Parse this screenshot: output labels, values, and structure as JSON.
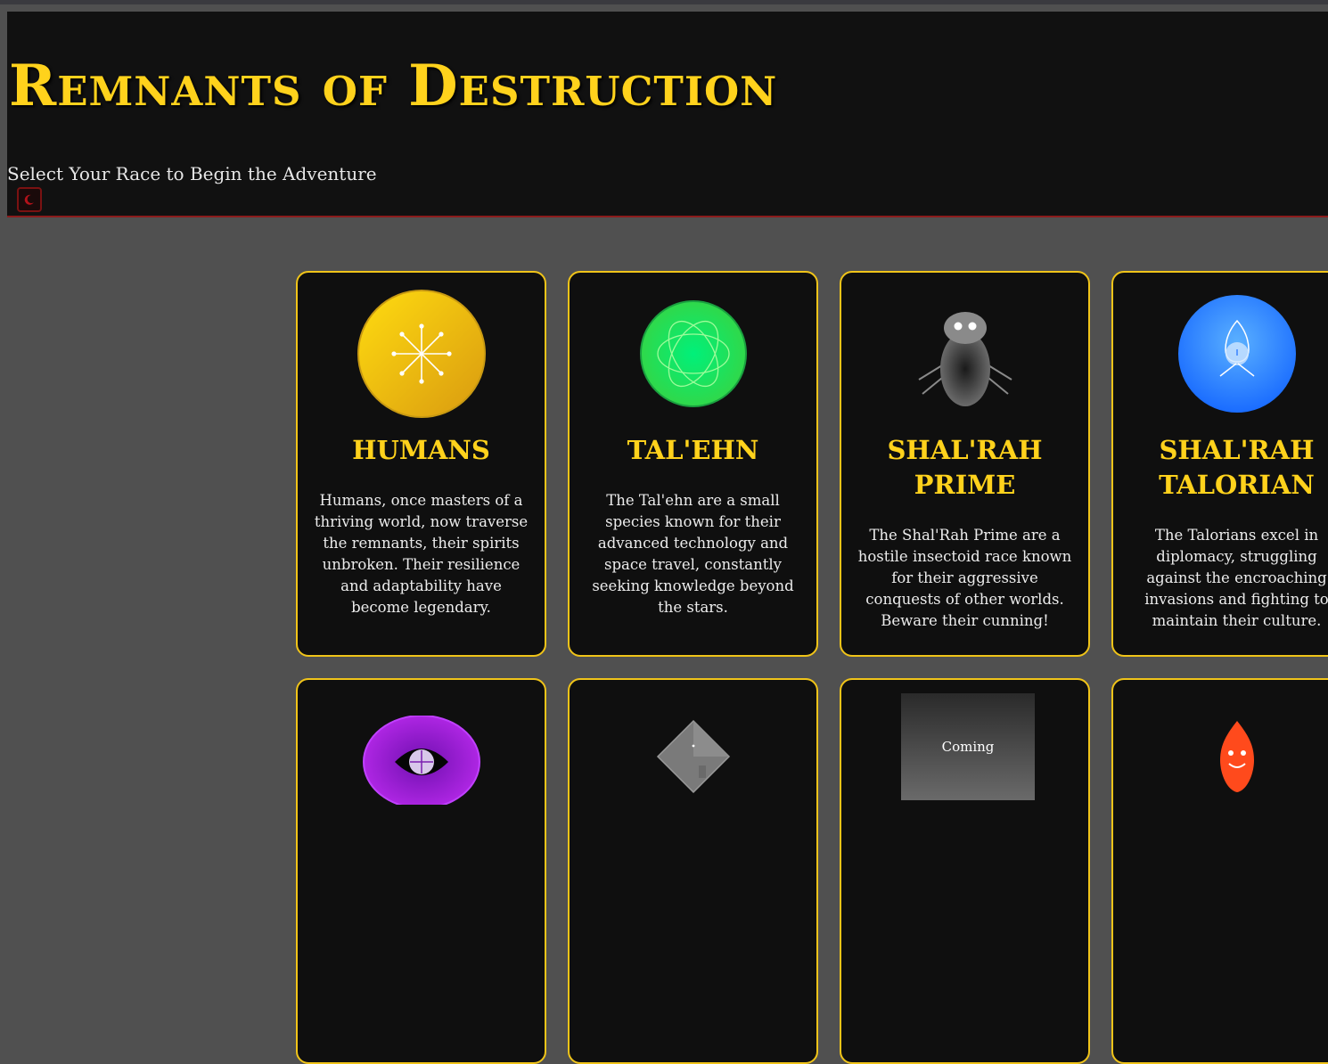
{
  "header": {
    "title": "Remnants of Destruction",
    "subtitle": "Select Your Race to Begin the Adventure",
    "theme_toggle_icon": "moon-icon"
  },
  "races": [
    {
      "name": "HUMANS",
      "description": "Humans, once masters of a thriving world, now traverse the remnants, their spirits unbroken. Their resilience and adaptability have become legendary.",
      "icon": "starburst-icon",
      "color": "#ffd21c"
    },
    {
      "name": "TAL'EHN",
      "description": "The Tal'ehn are a small species known for their advanced technology and space travel, constantly seeking knowledge beyond the stars.",
      "icon": "atom-orbit-icon",
      "color": "#22e05a"
    },
    {
      "name": "SHAL'RAH PRIME",
      "description": "The Shal'Rah Prime are a hostile insectoid race known for their aggressive conquests of other worlds. Beware their cunning!",
      "icon": "beetle-icon",
      "color": "#777777"
    },
    {
      "name": "SHAL'RAH TALORIAN",
      "description": "The Talorians excel in diplomacy, struggling against the encroaching invasions and fighting to maintain their culture.",
      "icon": "flame-orb-icon",
      "color": "#2a8cff"
    }
  ],
  "second_row": [
    {
      "icon": "eye-icon",
      "color": "#a020e0"
    },
    {
      "icon": "diamond-icon",
      "color": "#7a7a7a"
    },
    {
      "coming_label": "Coming"
    },
    {
      "icon": "flame-face-icon",
      "color": "#ff4a1c"
    }
  ]
}
